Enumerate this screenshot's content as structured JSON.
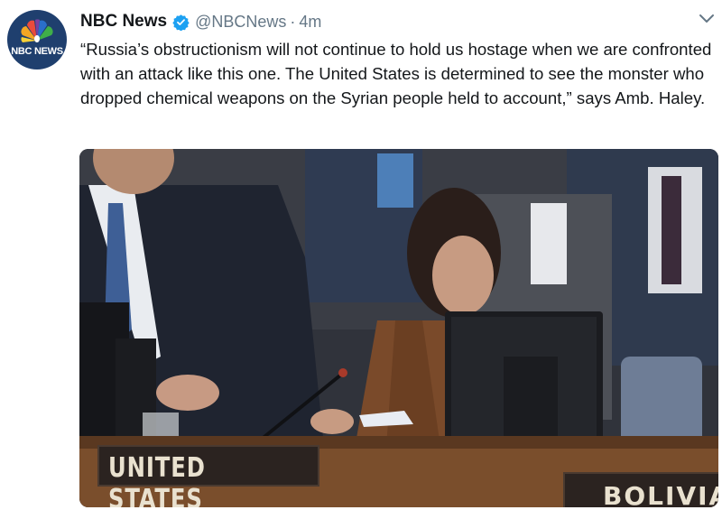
{
  "tweet": {
    "avatar_text": "NBC NEWS",
    "display_name": "NBC News",
    "handle": "@NBCNews",
    "separator": "·",
    "timestamp": "4m",
    "text": "“Russia’s obstructionism will not continue to hold us hostage when we are confronted with an attack like this one. The United States is determined to see the monster who dropped chemical weapons on the Syrian people held to account,” says Amb. Haley."
  },
  "photo": {
    "placards": {
      "united_states": "UNITED STATES",
      "bolivia": "BOLIVIA"
    }
  },
  "icons": {
    "verified": "verified-badge-icon",
    "caret": "chevron-down-icon",
    "logo": "nbc-peacock-icon"
  },
  "colors": {
    "verified": "#1da1f2",
    "text": "#14171a",
    "secondary_text": "#657786",
    "avatar_bg": "#1f3f6e"
  }
}
